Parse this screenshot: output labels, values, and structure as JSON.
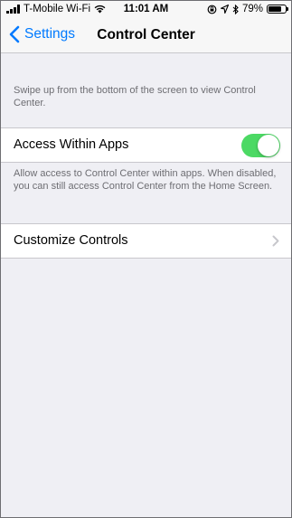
{
  "status_bar": {
    "carrier": "T-Mobile Wi-Fi",
    "time": "11:01 AM",
    "battery_percent": "79%",
    "battery_level": 0.79,
    "icons": [
      "signal-icon",
      "wifi-icon",
      "rotation-lock-icon",
      "location-icon",
      "bluetooth-icon",
      "battery-icon"
    ]
  },
  "nav": {
    "back_label": "Settings",
    "title": "Control Center"
  },
  "sections": {
    "intro_text": "Swipe up from the bottom of the screen to view Control Center.",
    "access_within_apps": {
      "label": "Access Within Apps",
      "toggle_on": true
    },
    "access_footer": "Allow access to Control Center within apps. When disabled, you can still access Control Center from the Home Screen.",
    "customize_controls": {
      "label": "Customize Controls"
    }
  },
  "colors": {
    "accent": "#007aff",
    "toggle_on": "#4cd964",
    "background": "#efeff4",
    "footer_text": "#6d6d72"
  }
}
